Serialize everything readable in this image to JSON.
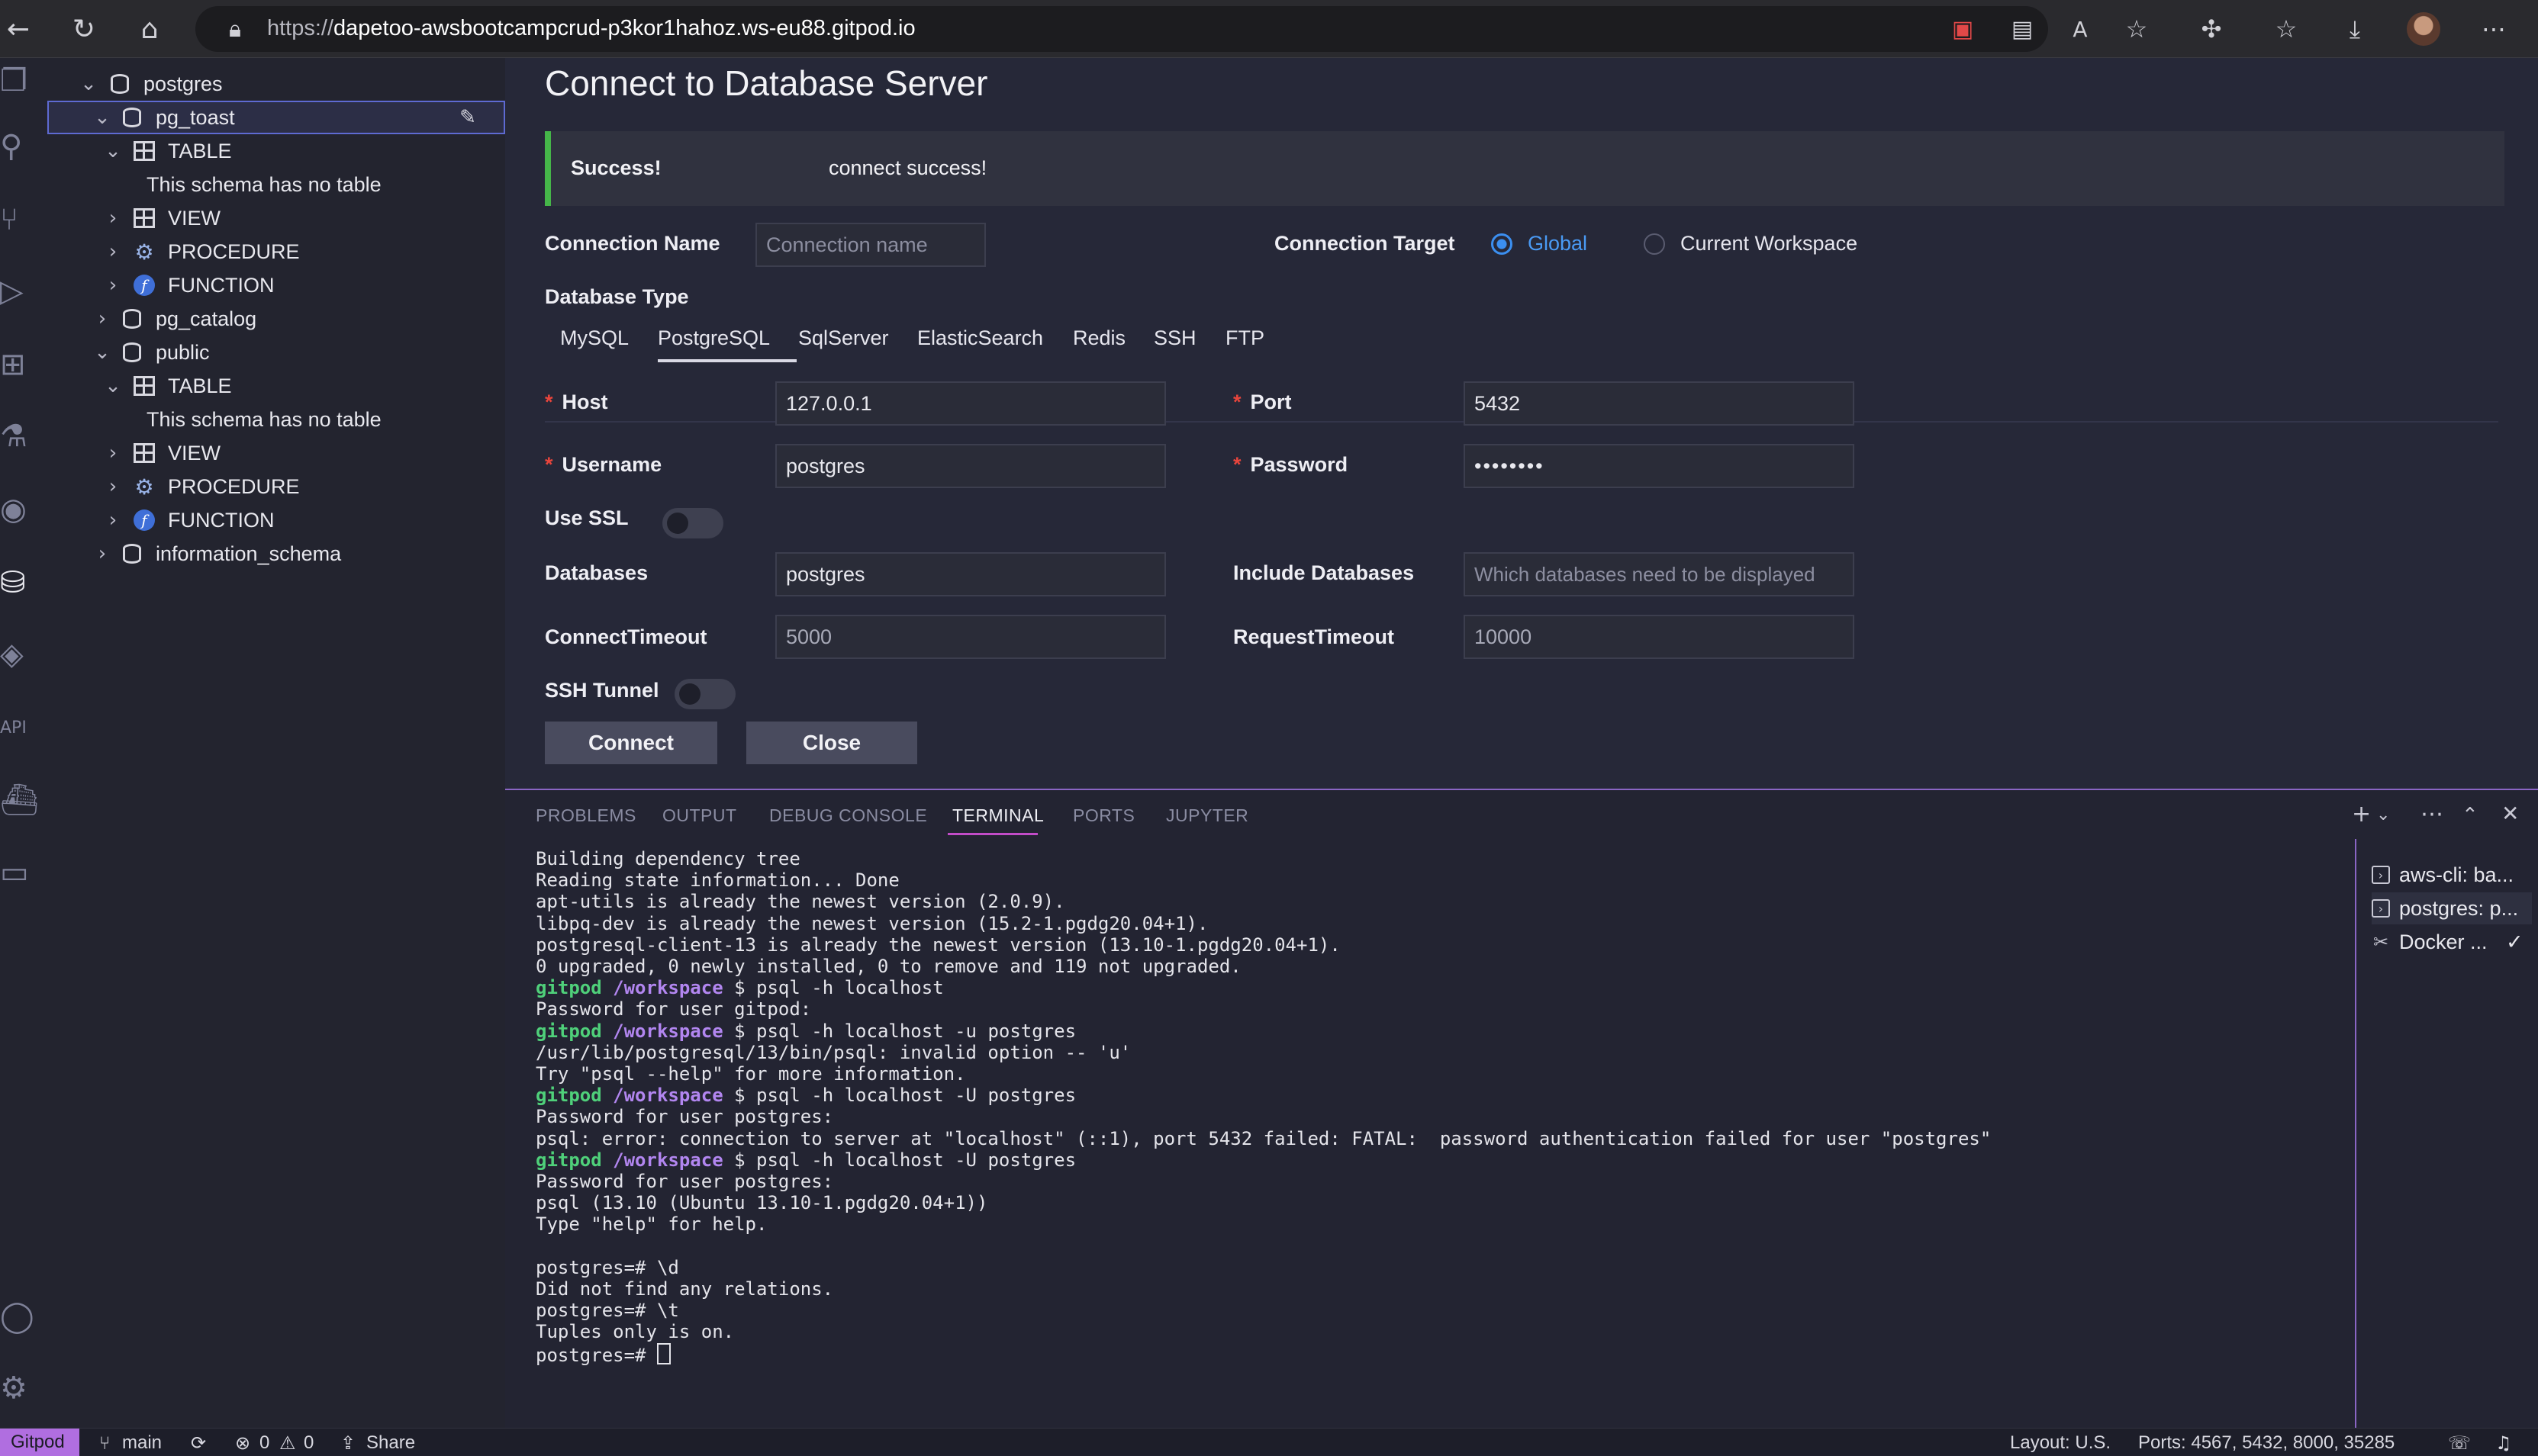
{
  "browser": {
    "url_scheme": "https://",
    "url_host": "dapetoo-awsbootcampcrud-p3kor1hahoz.ws-eu88.gitpod.io"
  },
  "sidebar": {
    "rows": [
      {
        "label": "postgres"
      },
      {
        "label": "pg_toast"
      },
      {
        "label": "TABLE"
      },
      {
        "label": "This schema has no table"
      },
      {
        "label": "VIEW"
      },
      {
        "label": "PROCEDURE"
      },
      {
        "label": "FUNCTION"
      },
      {
        "label": "pg_catalog"
      },
      {
        "label": "public"
      },
      {
        "label": "TABLE"
      },
      {
        "label": "This schema has no table"
      },
      {
        "label": "VIEW"
      },
      {
        "label": "PROCEDURE"
      },
      {
        "label": "FUNCTION"
      },
      {
        "label": "information_schema"
      }
    ]
  },
  "form": {
    "title": "Connect to Database Server",
    "alert_title": "Success!",
    "alert_message": "connect success!",
    "connection_name_label": "Connection Name",
    "connection_name_placeholder": "Connection name",
    "connection_target_label": "Connection Target",
    "target_global": "Global",
    "target_workspace": "Current Workspace",
    "database_type_label": "Database Type",
    "db_types": [
      "MySQL",
      "PostgreSQL",
      "SqlServer",
      "ElasticSearch",
      "Redis",
      "SSH",
      "FTP"
    ],
    "active_db_type": "PostgreSQL",
    "host_label": "Host",
    "host_value": "127.0.0.1",
    "port_label": "Port",
    "port_value": "5432",
    "username_label": "Username",
    "username_value": "postgres",
    "password_label": "Password",
    "password_value": "••••••••",
    "use_ssl_label": "Use SSL",
    "databases_label": "Databases",
    "databases_value": "postgres",
    "include_databases_label": "Include Databases",
    "include_databases_placeholder": "Which databases need to be displayed",
    "connect_timeout_label": "ConnectTimeout",
    "connect_timeout_value": "5000",
    "request_timeout_label": "RequestTimeout",
    "request_timeout_value": "10000",
    "ssh_tunnel_label": "SSH Tunnel",
    "connect_button": "Connect",
    "close_button": "Close"
  },
  "panel": {
    "tabs": [
      "PROBLEMS",
      "OUTPUT",
      "DEBUG CONSOLE",
      "TERMINAL",
      "PORTS",
      "JUPYTER"
    ],
    "active_tab": "TERMINAL",
    "terminal_lines": [
      {
        "text": "Building dependency tree"
      },
      {
        "text": "Reading state information... Done"
      },
      {
        "text": "apt-utils is already the newest version (2.0.9)."
      },
      {
        "text": "libpq-dev is already the newest version (15.2-1.pgdg20.04+1)."
      },
      {
        "text": "postgresql-client-13 is already the newest version (13.10-1.pgdg20.04+1)."
      },
      {
        "text": "0 upgraded, 0 newly installed, 0 to remove and 119 not upgraded."
      },
      {
        "user": "gitpod",
        "path": "/workspace",
        "text": " $ psql -h localhost"
      },
      {
        "text": "Password for user gitpod:"
      },
      {
        "user": "gitpod",
        "path": "/workspace",
        "text": " $ psql -h localhost -u postgres"
      },
      {
        "text": "/usr/lib/postgresql/13/bin/psql: invalid option -- 'u'"
      },
      {
        "text": "Try \"psql --help\" for more information."
      },
      {
        "user": "gitpod",
        "path": "/workspace",
        "text": " $ psql -h localhost -U postgres"
      },
      {
        "text": "Password for user postgres:"
      },
      {
        "text": "psql: error: connection to server at \"localhost\" (::1), port 5432 failed: FATAL:  password authentication failed for user \"postgres\""
      },
      {
        "user": "gitpod",
        "path": "/workspace",
        "text": " $ psql -h localhost -U postgres"
      },
      {
        "text": "Password for user postgres:"
      },
      {
        "text": "psql (13.10 (Ubuntu 13.10-1.pgdg20.04+1))"
      },
      {
        "text": "Type \"help\" for help."
      },
      {
        "text": ""
      },
      {
        "text": "postgres=# \\d"
      },
      {
        "text": "Did not find any relations."
      },
      {
        "text": "postgres=# \\t"
      },
      {
        "text": "Tuples only is on."
      },
      {
        "text": "postgres=# ",
        "cursor": true
      }
    ],
    "terminals": [
      {
        "label": "aws-cli: ba..."
      },
      {
        "label": "postgres: p..."
      },
      {
        "label": "Docker ..."
      }
    ]
  },
  "statusbar": {
    "gitpod": "Gitpod",
    "branch": "main",
    "errors": "0",
    "warnings": "0",
    "share": "Share",
    "layout": "Layout: U.S.",
    "ports": "Ports: 4567, 5432, 8000, 35285"
  }
}
